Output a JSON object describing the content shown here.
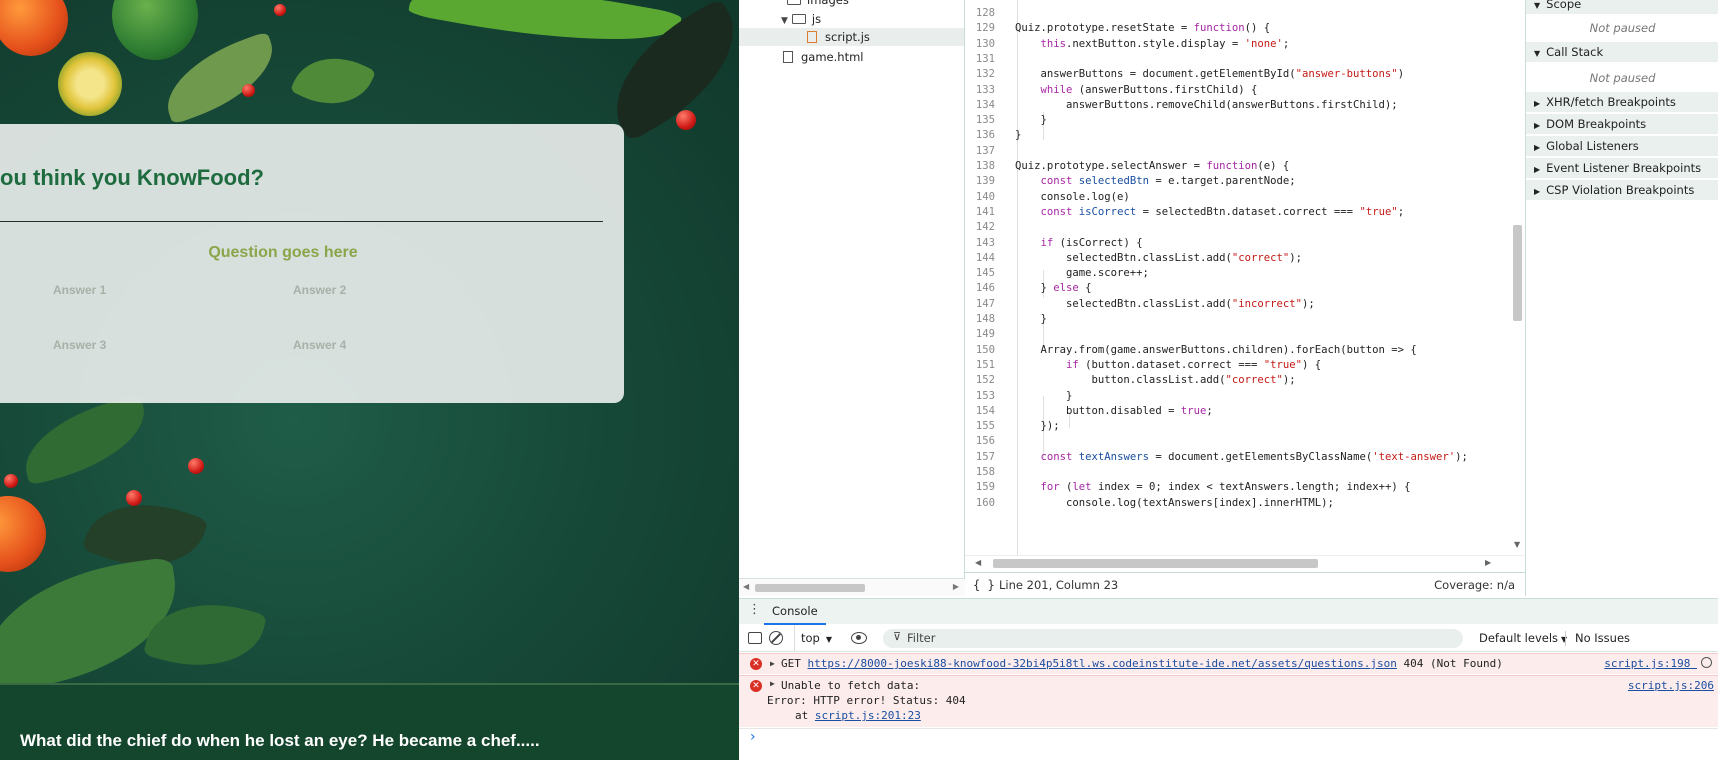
{
  "quiz": {
    "title": "ou think you KnowFood?",
    "question": "Question goes here",
    "answers": [
      "Answer 1",
      "Answer 2",
      "Answer 3",
      "Answer 4"
    ]
  },
  "footer": {
    "joke": "What did the chief do when he lost an eye? He became a chef....."
  },
  "navigator": {
    "folders": [
      "images",
      "js"
    ],
    "files": [
      "script.js",
      "game.html"
    ]
  },
  "editor": {
    "lines": [
      {
        "n": "128",
        "t": ""
      },
      {
        "n": "129",
        "t": "Quiz.prototype.resetState = function() {"
      },
      {
        "n": "130",
        "t": "    this.nextButton.style.display = 'none';"
      },
      {
        "n": "131",
        "t": ""
      },
      {
        "n": "132",
        "t": "    answerButtons = document.getElementById(\"answer-buttons\")"
      },
      {
        "n": "133",
        "t": "    while (answerButtons.firstChild) {"
      },
      {
        "n": "134",
        "t": "        answerButtons.removeChild(answerButtons.firstChild);"
      },
      {
        "n": "135",
        "t": "    }"
      },
      {
        "n": "136",
        "t": "}"
      },
      {
        "n": "137",
        "t": ""
      },
      {
        "n": "138",
        "t": "Quiz.prototype.selectAnswer = function(e) {"
      },
      {
        "n": "139",
        "t": "    const selectedBtn = e.target.parentNode;"
      },
      {
        "n": "140",
        "t": "    console.log(e)"
      },
      {
        "n": "141",
        "t": "    const isCorrect = selectedBtn.dataset.correct === \"true\";"
      },
      {
        "n": "142",
        "t": ""
      },
      {
        "n": "143",
        "t": "    if (isCorrect) {"
      },
      {
        "n": "144",
        "t": "        selectedBtn.classList.add(\"correct\");"
      },
      {
        "n": "145",
        "t": "        game.score++;"
      },
      {
        "n": "146",
        "t": "    } else {"
      },
      {
        "n": "147",
        "t": "        selectedBtn.classList.add(\"incorrect\");"
      },
      {
        "n": "148",
        "t": "    }"
      },
      {
        "n": "149",
        "t": ""
      },
      {
        "n": "150",
        "t": "    Array.from(game.answerButtons.children).forEach(button => {"
      },
      {
        "n": "151",
        "t": "        if (button.dataset.correct === \"true\") {"
      },
      {
        "n": "152",
        "t": "            button.classList.add(\"correct\");"
      },
      {
        "n": "153",
        "t": "        }"
      },
      {
        "n": "154",
        "t": "        button.disabled = true;"
      },
      {
        "n": "155",
        "t": "    });"
      },
      {
        "n": "156",
        "t": ""
      },
      {
        "n": "157",
        "t": "    const textAnswers = document.getElementsByClassName('text-answer');"
      },
      {
        "n": "158",
        "t": ""
      },
      {
        "n": "159",
        "t": "    for (let index = 0; index < textAnswers.length; index++) {"
      },
      {
        "n": "160",
        "t": "        console.log(textAnswers[index].innerHTML);"
      }
    ]
  },
  "status": {
    "position": "Line 201, Column 23",
    "coverage": "Coverage: n/a"
  },
  "debugger": {
    "scope_label": "Scope",
    "not_paused": "Not paused",
    "call_stack_label": "Call Stack",
    "sections": [
      "XHR/fetch Breakpoints",
      "DOM Breakpoints",
      "Global Listeners",
      "Event Listener Breakpoints",
      "CSP Violation Breakpoints"
    ]
  },
  "drawer": {
    "tab": "Console",
    "context": "top",
    "filter_placeholder": "Filter",
    "levels": "Default levels",
    "issues": "No Issues"
  },
  "console": {
    "msg1": {
      "method": "GET",
      "url": "https://8000-joeski88-knowfood-32bi4p5i8tl.ws.codeinstitute-ide.net/assets/questions.json",
      "status": "404 (Not Found)",
      "source": "script.js:198"
    },
    "msg2": {
      "line1": "Unable to fetch data:",
      "line2": "Error: HTTP error! Status: 404",
      "at_prefix": "at",
      "at_link": "script.js:201:23",
      "source": "script.js:206"
    },
    "prompt": "›"
  },
  "colors": {
    "title_green": "#1d6b3f",
    "question_olive": "#8aa54a",
    "error_red": "#d93025",
    "keyword": "#a626a4",
    "string": "#c41a16",
    "declared": "#1a4ea0"
  }
}
